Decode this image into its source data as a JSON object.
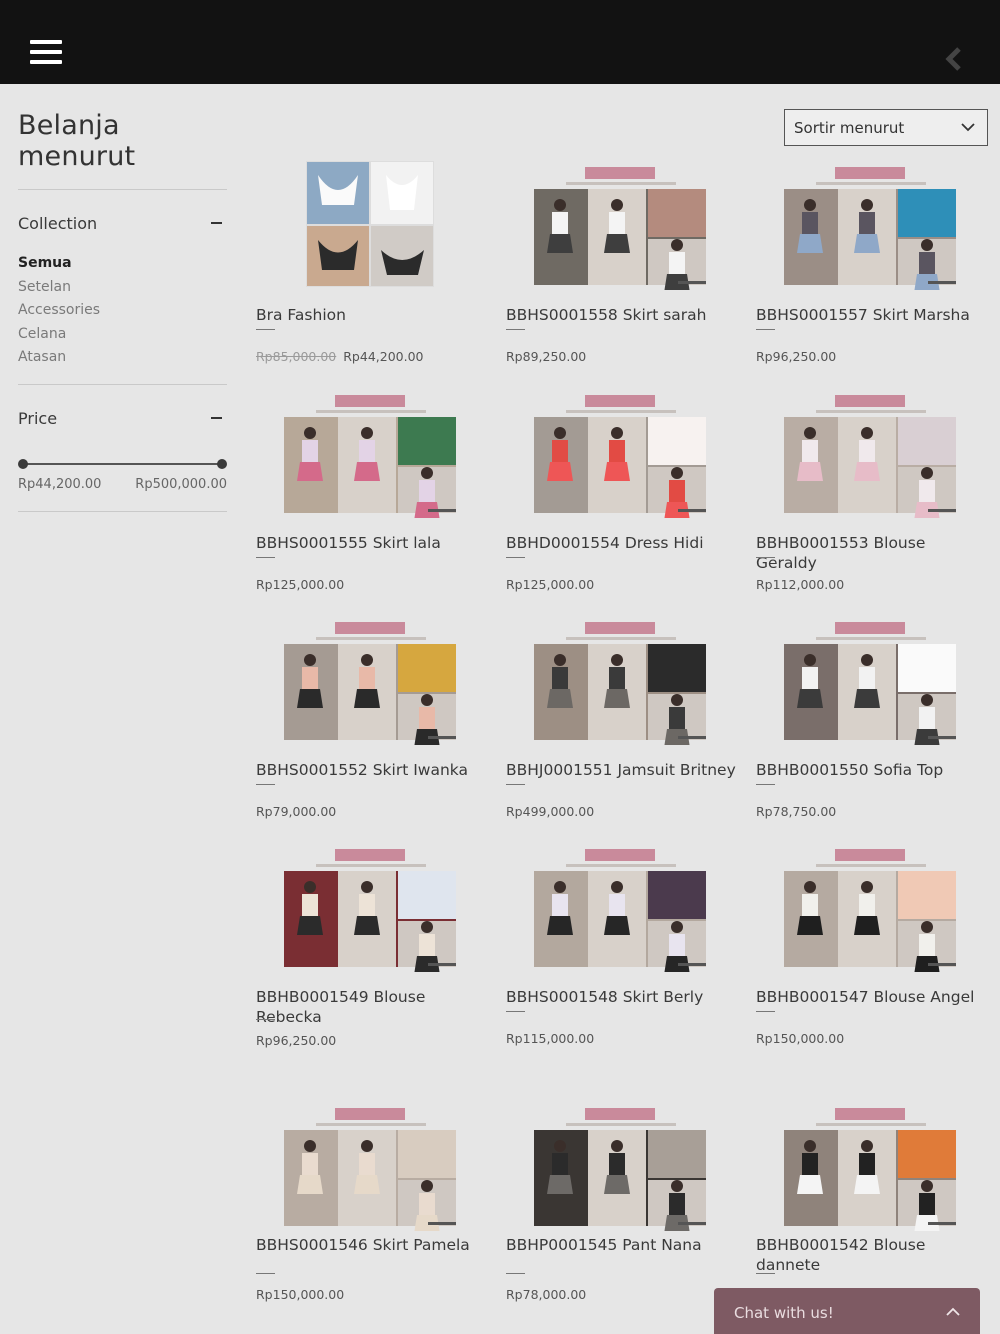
{
  "header": {
    "menu_icon": "hamburger-icon",
    "back_icon": "chevron-left-icon"
  },
  "sidebar": {
    "title": "Belanja menurut",
    "collection": {
      "label": "Collection",
      "items": [
        {
          "label": "Semua",
          "active": true
        },
        {
          "label": "Setelan",
          "active": false
        },
        {
          "label": "Accessories",
          "active": false
        },
        {
          "label": "Celana",
          "active": false
        },
        {
          "label": "Atasan",
          "active": false
        }
      ]
    },
    "price": {
      "label": "Price",
      "min": "Rp44,200.00",
      "max": "Rp500,000.00",
      "low_fraction": 0,
      "high_fraction": 1
    }
  },
  "sort": {
    "label": "Sortir menurut"
  },
  "products": [
    {
      "name": "Bra Fashion",
      "old_price": "Rp85,000.00",
      "price": "Rp44,200.00"
    },
    {
      "name": "BBHS0001558 Skirt sarah",
      "old_price": "",
      "price": "Rp89,250.00"
    },
    {
      "name": "BBHS0001557 Skirt Marsha",
      "old_price": "",
      "price": "Rp96,250.00"
    },
    {
      "name": "BBHS0001555 Skirt lala",
      "old_price": "",
      "price": "Rp125,000.00"
    },
    {
      "name": "BBHD0001554 Dress Hidi",
      "old_price": "",
      "price": "Rp125,000.00"
    },
    {
      "name": "BBHB0001553 Blouse Geraldy",
      "old_price": "",
      "price": "Rp112,000.00"
    },
    {
      "name": "BBHS0001552 Skirt Iwanka",
      "old_price": "",
      "price": "Rp79,000.00"
    },
    {
      "name": "BBHJ0001551 Jamsuit Britney",
      "old_price": "",
      "price": "Rp499,000.00"
    },
    {
      "name": "BBHB0001550 Sofia Top",
      "old_price": "",
      "price": "Rp78,750.00"
    },
    {
      "name": "BBHB0001549 Blouse Rebecka",
      "old_price": "",
      "price": "Rp96,250.00"
    },
    {
      "name": "BBHS0001548 Skirt Berly",
      "old_price": "",
      "price": "Rp115,000.00"
    },
    {
      "name": "BBHB0001547 Blouse Angel",
      "old_price": "",
      "price": "Rp150,000.00"
    },
    {
      "name": "BBHS0001546 Skirt Pamela",
      "old_price": "",
      "price": "Rp150,000.00"
    },
    {
      "name": "BBHP0001545 Pant Nana",
      "old_price": "",
      "price": "Rp78,000.00"
    },
    {
      "name": "BBHB0001542 Blouse dannete",
      "old_price": "",
      "price": ""
    }
  ],
  "chat": {
    "label": "Chat with us!"
  },
  "colors": {
    "topbar": "#121212",
    "background": "#e6e6e6",
    "chat": "#7e5a63",
    "banner": "#c98a9b"
  }
}
